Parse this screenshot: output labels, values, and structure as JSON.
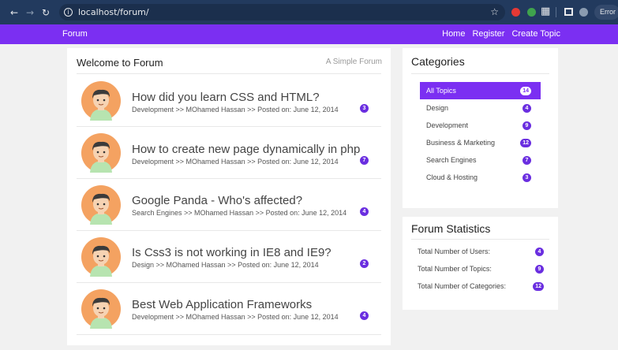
{
  "browser": {
    "url": "localhost/forum/",
    "error_label": "Error",
    "icons": [
      "back-icon",
      "forward-icon",
      "reload-icon",
      "info-icon",
      "star-icon",
      "extensions-icon",
      "side-panel-icon",
      "profile-icon"
    ]
  },
  "navbar": {
    "brand": "Forum",
    "links": [
      "Home",
      "Register",
      "Create Topic"
    ],
    "color": "#7b2ff2"
  },
  "main": {
    "title": "Welcome to Forum",
    "subtitle": "A Simple Forum",
    "topics": [
      {
        "title": "How did you learn CSS and HTML?",
        "meta": "Development >> MOhamed Hassan >> Posted on: June 12, 2014",
        "replies": "3"
      },
      {
        "title": "How to create new page dynamically in php",
        "meta": "Development >> MOhamed Hassan >> Posted on: June 12, 2014",
        "replies": "7"
      },
      {
        "title": "Google Panda - Who's affected?",
        "meta": "Search Engines >> MOhamed Hassan >> Posted on: June 12, 2014",
        "replies": "4"
      },
      {
        "title": "Is Css3 is not working in IE8 and IE9?",
        "meta": "Design >> MOhamed Hassan >> Posted on: June 12, 2014",
        "replies": "2"
      },
      {
        "title": "Best Web Application Frameworks",
        "meta": "Development >> MOhamed Hassan >> Posted on: June 12, 2014",
        "replies": "4"
      }
    ]
  },
  "categories": {
    "title": "Categories",
    "items": [
      {
        "label": "All Topics",
        "count": "14",
        "active": true
      },
      {
        "label": "Design",
        "count": "4"
      },
      {
        "label": "Development",
        "count": "9"
      },
      {
        "label": "Business & Marketing",
        "count": "12"
      },
      {
        "label": "Search Engines",
        "count": "7"
      },
      {
        "label": "Cloud & Hosting",
        "count": "3"
      }
    ]
  },
  "stats": {
    "title": "Forum Statistics",
    "rows": [
      {
        "label": "Total Number of Users:",
        "value": "4"
      },
      {
        "label": "Total Number of Topics:",
        "value": "9"
      },
      {
        "label": "Total Number of Categories:",
        "value": "12"
      }
    ]
  }
}
